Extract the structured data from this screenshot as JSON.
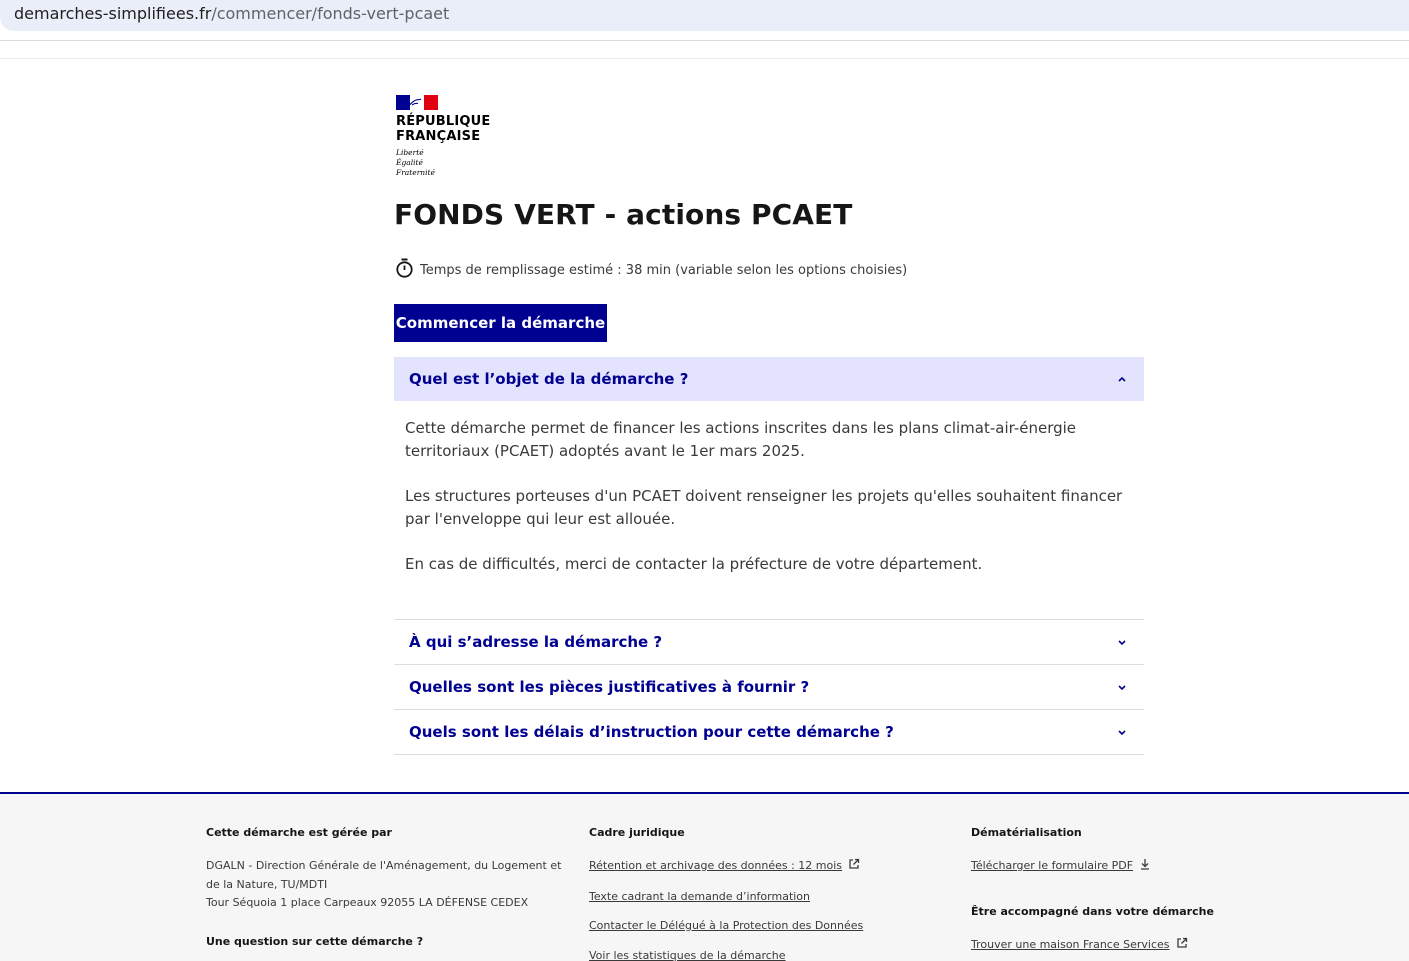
{
  "browser": {
    "url_domain": "demarches-simplifiees.fr",
    "url_path": "/commencer/fonds-vert-pcaet"
  },
  "logo": {
    "line1": "RÉPUBLIQUE",
    "line2": "FRANÇAISE",
    "motto1": "Liberté",
    "motto2": "Égalité",
    "motto3": "Fraternité"
  },
  "page": {
    "title": "FONDS VERT - actions PCAET",
    "estimate": "Temps de remplissage estimé : 38 min (variable selon les options choisies)",
    "start_button": "Commencer la démarche"
  },
  "accordions": [
    {
      "label": "Quel est l’objet de la démarche ?",
      "expanded": true,
      "paragraphs": [
        "Cette démarche permet de financer les actions inscrites dans les plans climat-air-énergie territoriaux (PCAET) adoptés avant le 1er mars 2025.",
        "Les structures porteuses d'un PCAET doivent renseigner les projets qu'elles souhaitent financer par l'enveloppe qui leur est allouée.",
        "En cas de difficultés, merci de contacter la préfecture de votre département."
      ]
    },
    {
      "label": "À qui s’adresse la démarche ?",
      "expanded": false
    },
    {
      "label": "Quelles sont les pièces justificatives à fournir ?",
      "expanded": false
    },
    {
      "label": "Quels sont les délais d’instruction pour cette démarche ?",
      "expanded": false
    }
  ],
  "footer": {
    "managed_heading": "Cette démarche est gérée par",
    "managed_text_1": "DGALN - Direction Générale de l'Aménagement, du Logement et de la Nature, TU/MDTI",
    "managed_text_2": "Tour Séquoia 1 place Carpeaux 92055 LA DÉFENSE CEDEX",
    "question_heading": "Une question sur cette démarche ?",
    "legal_heading": "Cadre juridique",
    "legal_links": [
      "Rétention et archivage des données : 12 mois",
      "Texte cadrant la demande d’information",
      "Contacter le Délégué à la Protection des Données",
      "Voir les statistiques de la démarche"
    ],
    "dematerialisation_heading": "Dématérialisation",
    "pdf_link": "Télécharger le formulaire PDF",
    "help_heading": "Être accompagné dans votre démarche",
    "france_services_link": "Trouver une maison France Services"
  },
  "colors": {
    "primary_blue": "#000091",
    "accordion_open_bg": "#e3e3fd",
    "flag_red": "#e1000f",
    "footer_bg": "#f6f6f6"
  }
}
